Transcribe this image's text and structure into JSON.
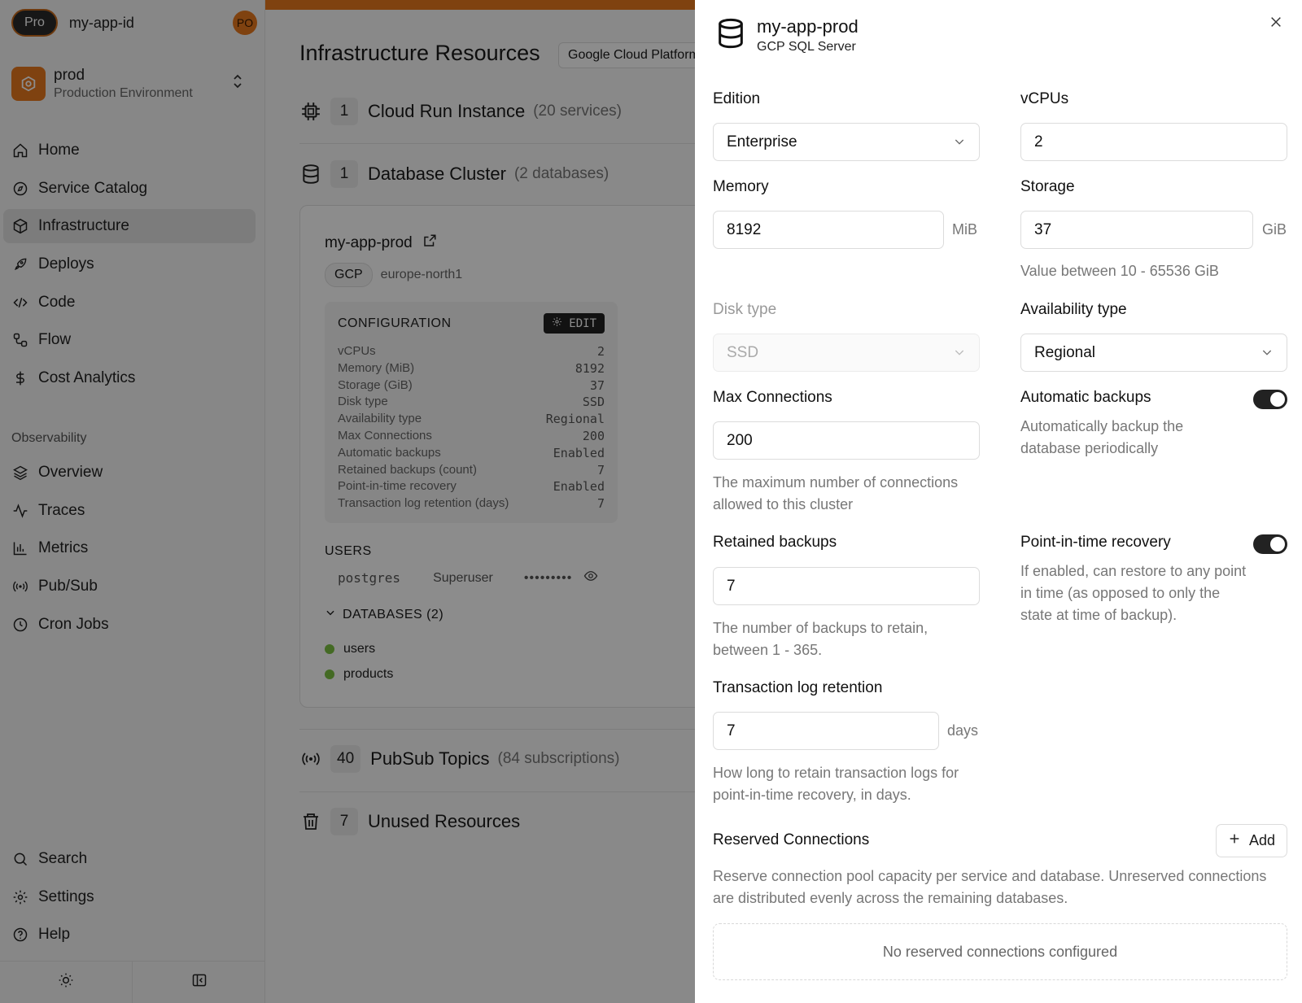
{
  "topbar": {
    "plan_badge": "Pro",
    "app_id": "my-app-id",
    "user_initials": "PO"
  },
  "environment": {
    "name": "prod",
    "description": "Production Environment"
  },
  "nav": {
    "items": [
      {
        "label": "Home",
        "icon": "home-icon"
      },
      {
        "label": "Service Catalog",
        "icon": "compass-icon"
      },
      {
        "label": "Infrastructure",
        "icon": "cube-icon",
        "active": true
      },
      {
        "label": "Deploys",
        "icon": "rocket-icon"
      },
      {
        "label": "Code",
        "icon": "code-icon"
      },
      {
        "label": "Flow",
        "icon": "flow-icon"
      },
      {
        "label": "Cost Analytics",
        "icon": "dollar-icon"
      }
    ],
    "observability_heading": "Observability",
    "observability_items": [
      {
        "label": "Overview",
        "icon": "layers-icon"
      },
      {
        "label": "Traces",
        "icon": "activity-icon"
      },
      {
        "label": "Metrics",
        "icon": "bar-chart-icon"
      },
      {
        "label": "Pub/Sub",
        "icon": "broadcast-icon"
      },
      {
        "label": "Cron Jobs",
        "icon": "clock-icon"
      }
    ],
    "bottom_items": [
      {
        "label": "Search",
        "icon": "search-icon"
      },
      {
        "label": "Settings",
        "icon": "gear-icon"
      },
      {
        "label": "Help",
        "icon": "help-icon"
      }
    ]
  },
  "main": {
    "title": "Infrastructure Resources",
    "provider": "Google Cloud Platform",
    "resources": [
      {
        "count": "1",
        "name": "Cloud Run Instance",
        "sub": "(20 services)",
        "icon": "cpu-icon"
      },
      {
        "count": "1",
        "name": "Database Cluster",
        "sub": "(2 databases)",
        "icon": "database-icon"
      },
      {
        "count": "40",
        "name": "PubSub Topics",
        "sub": "(84 subscriptions)",
        "icon": "broadcast-icon"
      },
      {
        "count": "7",
        "name": "Unused Resources",
        "sub": "",
        "icon": "trash-icon"
      }
    ],
    "cluster": {
      "name": "my-app-prod",
      "cloud": "GCP",
      "region": "europe-north1",
      "config_heading": "CONFIGURATION",
      "edit_label": "EDIT",
      "config": [
        {
          "k": "vCPUs",
          "v": "2"
        },
        {
          "k": "Memory (MiB)",
          "v": "8192"
        },
        {
          "k": "Storage (GiB)",
          "v": "37"
        },
        {
          "k": "Disk type",
          "v": "SSD"
        },
        {
          "k": "Availability type",
          "v": "Regional"
        },
        {
          "k": "Max Connections",
          "v": "200"
        },
        {
          "k": "Automatic backups",
          "v": "Enabled"
        },
        {
          "k": "Retained backups (count)",
          "v": "7"
        },
        {
          "k": "Point-in-time recovery",
          "v": "Enabled"
        },
        {
          "k": "Transaction log retention (days)",
          "v": "7"
        }
      ],
      "users_heading": "USERS",
      "user": {
        "name": "postgres",
        "role": "Superuser",
        "password": "•••••••••"
      },
      "databases_heading": "DATABASES (2)",
      "databases": [
        "users",
        "products"
      ]
    }
  },
  "panel": {
    "title": "my-app-prod",
    "subtitle": "GCP SQL Server",
    "edition": {
      "label": "Edition",
      "value": "Enterprise"
    },
    "vcpus": {
      "label": "vCPUs",
      "value": "2"
    },
    "memory": {
      "label": "Memory",
      "value": "8192",
      "unit": "MiB"
    },
    "storage": {
      "label": "Storage",
      "value": "37",
      "unit": "GiB",
      "help": "Value between 10 - 65536 GiB"
    },
    "disk_type": {
      "label": "Disk type",
      "value": "SSD"
    },
    "availability": {
      "label": "Availability type",
      "value": "Regional"
    },
    "max_connections": {
      "label": "Max Connections",
      "value": "200",
      "help": "The maximum number of connections allowed to this cluster"
    },
    "auto_backups": {
      "label": "Automatic backups",
      "help": "Automatically backup the database periodically",
      "enabled": true
    },
    "retained_backups": {
      "label": "Retained backups",
      "value": "7",
      "help": "The number of backups to retain, between 1 - 365."
    },
    "pitr": {
      "label": "Point-in-time recovery",
      "help": "If enabled, can restore to any point in time (as opposed to only the state at time of backup).",
      "enabled": true
    },
    "log_retention": {
      "label": "Transaction log retention",
      "value": "7",
      "unit": "days",
      "help": "How long to retain transaction logs for point-in-time recovery, in days."
    },
    "reserved": {
      "label": "Reserved Connections",
      "add_label": "Add",
      "help": "Reserve connection pool capacity per service and database. Unreserved connections are distributed evenly across the remaining databases.",
      "empty": "No reserved connections configured"
    }
  },
  "colors": {
    "accent": "#e8781e",
    "status_green": "#7cc242",
    "toggle_on": "#222222"
  }
}
